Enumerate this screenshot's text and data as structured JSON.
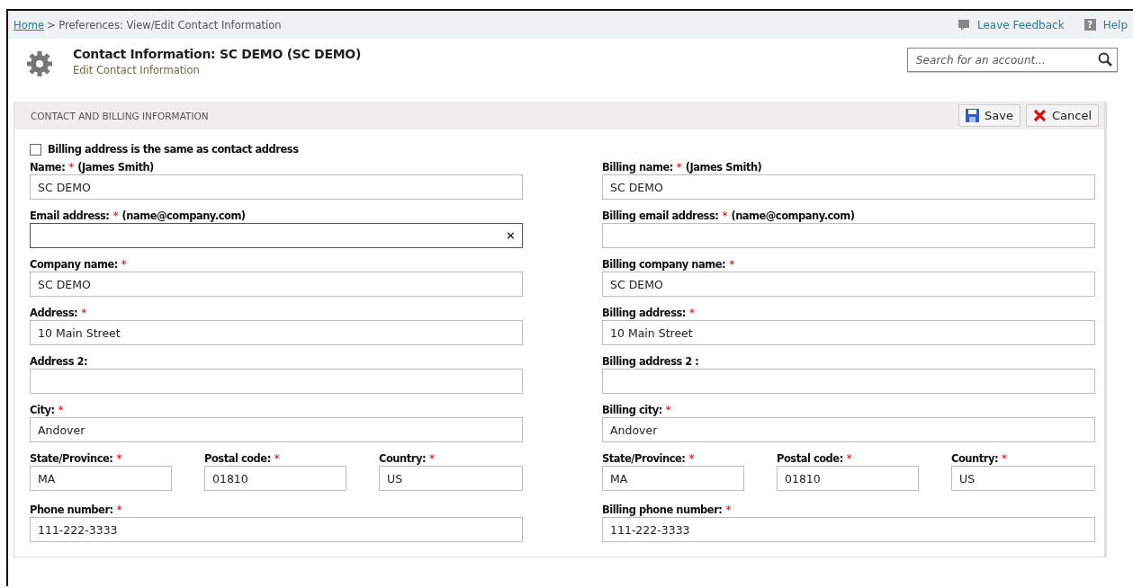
{
  "breadcrumb": {
    "home": "Home",
    "rest": "> Preferences: View/Edit Contact Information"
  },
  "top_links": [
    {
      "kind": "feedback",
      "label": "Leave Feedback"
    },
    {
      "kind": "help",
      "icon": "?",
      "label": "Help"
    }
  ],
  "header": {
    "title": "Contact Information: SC DEMO (SC DEMO)",
    "subtitle": "Edit Contact Information"
  },
  "search": {
    "placeholder": "Search for an account..."
  },
  "section": {
    "title": "CONTACT AND BILLING INFORMATION",
    "buttons": [
      {
        "kind": "save",
        "label": "Save"
      },
      {
        "kind": "cancel",
        "label": "Cancel"
      }
    ],
    "same_address": {
      "label": "Billing address is the same as contact address",
      "checked": false
    },
    "columns": [
      {
        "rows": [
          {
            "kind": "single",
            "fields": [
              {
                "label": "Name:",
                "required_mark": "*",
                "hint": "(James Smith)",
                "value": "SC DEMO",
                "focused": false
              }
            ]
          },
          {
            "kind": "single",
            "fields": [
              {
                "label": "Email address:",
                "required_mark": "*",
                "hint": "(name@company.com)",
                "focused": true,
                "clear": "×"
              }
            ]
          },
          {
            "kind": "single",
            "fields": [
              {
                "label": "Company name:",
                "required_mark": "*",
                "value": "SC DEMO",
                "focused": false
              }
            ]
          },
          {
            "kind": "single",
            "fields": [
              {
                "label": "Address:",
                "required_mark": "*",
                "value": "10 Main Street",
                "focused": false
              }
            ]
          },
          {
            "kind": "single",
            "fields": [
              {
                "label": "Address 2:",
                "focused": false
              }
            ]
          },
          {
            "kind": "single",
            "fields": [
              {
                "label": "City:",
                "required_mark": "*",
                "value": "Andover",
                "focused": false
              }
            ]
          },
          {
            "kind": "triple",
            "fields": [
              {
                "label": "State/Province:",
                "required_mark": "*",
                "value": "MA",
                "focused": false
              },
              {
                "label": "Postal code:",
                "required_mark": "*",
                "value": "01810",
                "focused": false
              },
              {
                "label": "Country:",
                "required_mark": "*",
                "value": "US",
                "focused": false
              }
            ]
          },
          {
            "kind": "single",
            "fields": [
              {
                "label": "Phone number:",
                "required_mark": "*",
                "value": "111-222-3333",
                "focused": false
              }
            ]
          }
        ]
      },
      {
        "rows": [
          {
            "kind": "single",
            "fields": [
              {
                "label": "Billing name:",
                "required_mark": "*",
                "hint": "(James Smith)",
                "value": "SC DEMO",
                "focused": false
              }
            ]
          },
          {
            "kind": "single",
            "fields": [
              {
                "label": "Billing email address:",
                "required_mark": "*",
                "hint": "(name@company.com)",
                "focused": false
              }
            ]
          },
          {
            "kind": "single",
            "fields": [
              {
                "label": "Billing company name:",
                "required_mark": "*",
                "value": "SC DEMO",
                "focused": false
              }
            ]
          },
          {
            "kind": "single",
            "fields": [
              {
                "label": "Billing address:",
                "required_mark": "*",
                "value": "10 Main Street",
                "focused": false
              }
            ]
          },
          {
            "kind": "single",
            "fields": [
              {
                "label": "Billing address 2 :",
                "focused": false
              }
            ]
          },
          {
            "kind": "single",
            "fields": [
              {
                "label": "Billing city:",
                "required_mark": "*",
                "value": "Andover",
                "focused": false
              }
            ]
          },
          {
            "kind": "triple",
            "fields": [
              {
                "label": "State/Province:",
                "required_mark": "*",
                "value": "MA",
                "focused": false
              },
              {
                "label": "Postal code:",
                "required_mark": "*",
                "value": "01810",
                "focused": false
              },
              {
                "label": "Country:",
                "required_mark": "*",
                "value": "US",
                "focused": false
              }
            ]
          },
          {
            "kind": "single",
            "fields": [
              {
                "label": "Billing phone number:",
                "required_mark": "*",
                "value": "111-222-3333",
                "focused": false
              }
            ]
          }
        ]
      }
    ]
  }
}
